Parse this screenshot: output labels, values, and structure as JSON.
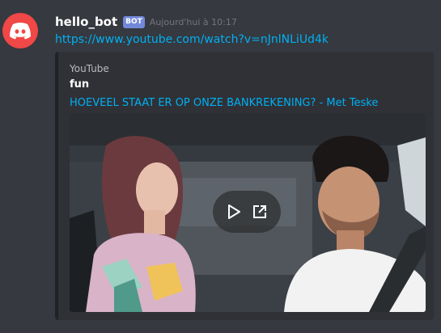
{
  "message": {
    "username": "hello_bot",
    "bot_tag": "BOT",
    "timestamp": "Aujourd'hui à 10:17",
    "link": "https://www.youtube.com/watch?v=nJnlNLiUd4k"
  },
  "embed": {
    "provider": "YouTube",
    "author": "fun",
    "title": "HOEVEEL STAAT ER OP ONZE BANKREKENING? - Met Teske"
  },
  "icons": {
    "avatar": "discord-logo-icon",
    "play": "play-icon",
    "external": "external-link-icon"
  },
  "colors": {
    "background": "#36393f",
    "embed_bg": "#2f3136",
    "link": "#00b0f4",
    "bot_tag": "#7289da",
    "avatar": "#f04747"
  }
}
